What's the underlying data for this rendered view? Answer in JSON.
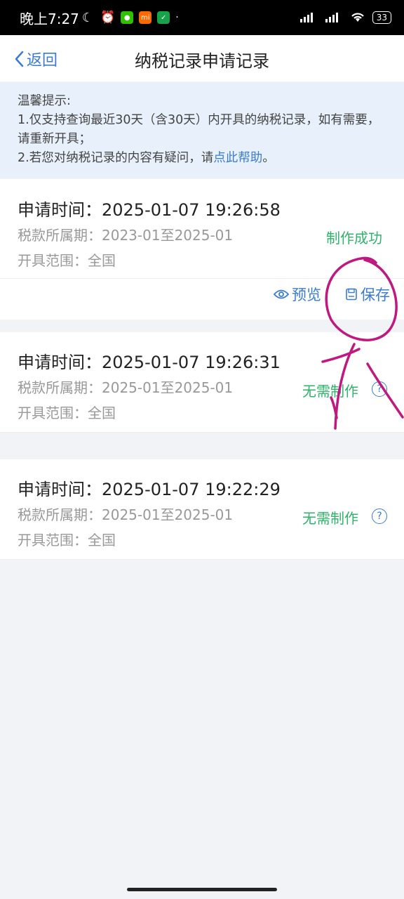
{
  "status_bar": {
    "time": "晚上7:27",
    "battery": "33",
    "app_mi": "mi"
  },
  "nav": {
    "back_label": "返回",
    "title": "纳税记录申请记录"
  },
  "notice": {
    "heading": "温馨提示:",
    "line1": "1.仅支持查询最近30天（含30天）内开具的纳税记录，如有需要，请重新开具；",
    "line2_prefix": "2.若您对纳税记录的内容有疑问，请",
    "line2_link": "点此帮助",
    "line2_suffix": "。"
  },
  "records": [
    {
      "request_time": "申请时间：2025-01-07 19:26:58",
      "period": "税款所属期：2023-01至2025-01",
      "scope": "开具范围：全国",
      "status": "制作成功",
      "actions": {
        "preview": "预览",
        "save": "保存"
      }
    },
    {
      "request_time": "申请时间：2025-01-07 19:26:31",
      "period": "税款所属期：2025-01至2025-01",
      "scope": "开具范围：全国",
      "status": "无需制作",
      "help": "?"
    },
    {
      "request_time": "申请时间：2025-01-07 19:22:29",
      "period": "税款所属期：2025-01至2025-01",
      "scope": "开具范围：全国",
      "status": "无需制作",
      "help": "?"
    }
  ],
  "colors": {
    "accent": "#3a7bd5",
    "success": "#2fb36a",
    "annotation": "#c0187f"
  }
}
